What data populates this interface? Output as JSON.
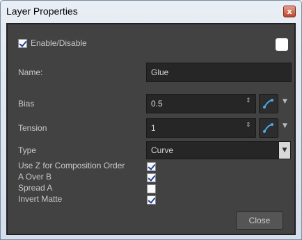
{
  "window": {
    "title": "Layer Properties",
    "close_glyph": "x"
  },
  "enable": {
    "label": "Enable/Disable",
    "checked": true
  },
  "name": {
    "label": "Name:",
    "value": "Glue"
  },
  "bias": {
    "label": "Bias",
    "value": "0.5"
  },
  "tension": {
    "label": "Tension",
    "value": "1"
  },
  "type": {
    "label": "Type",
    "value": "Curve"
  },
  "options": [
    {
      "label": "Use Z for Composition Order",
      "checked": true
    },
    {
      "label": "A Over B",
      "checked": true
    },
    {
      "label": "Spread A",
      "checked": false
    },
    {
      "label": "Invert Matte",
      "checked": true
    }
  ],
  "footer": {
    "close_label": "Close"
  },
  "icons": {
    "spin": "spinner-arrows-icon",
    "function": "function-curve-icon",
    "dropdown": "chevron-down-icon"
  },
  "colors": {
    "panel": "#424242",
    "field": "#262626",
    "accent": "#4aa8e8"
  }
}
